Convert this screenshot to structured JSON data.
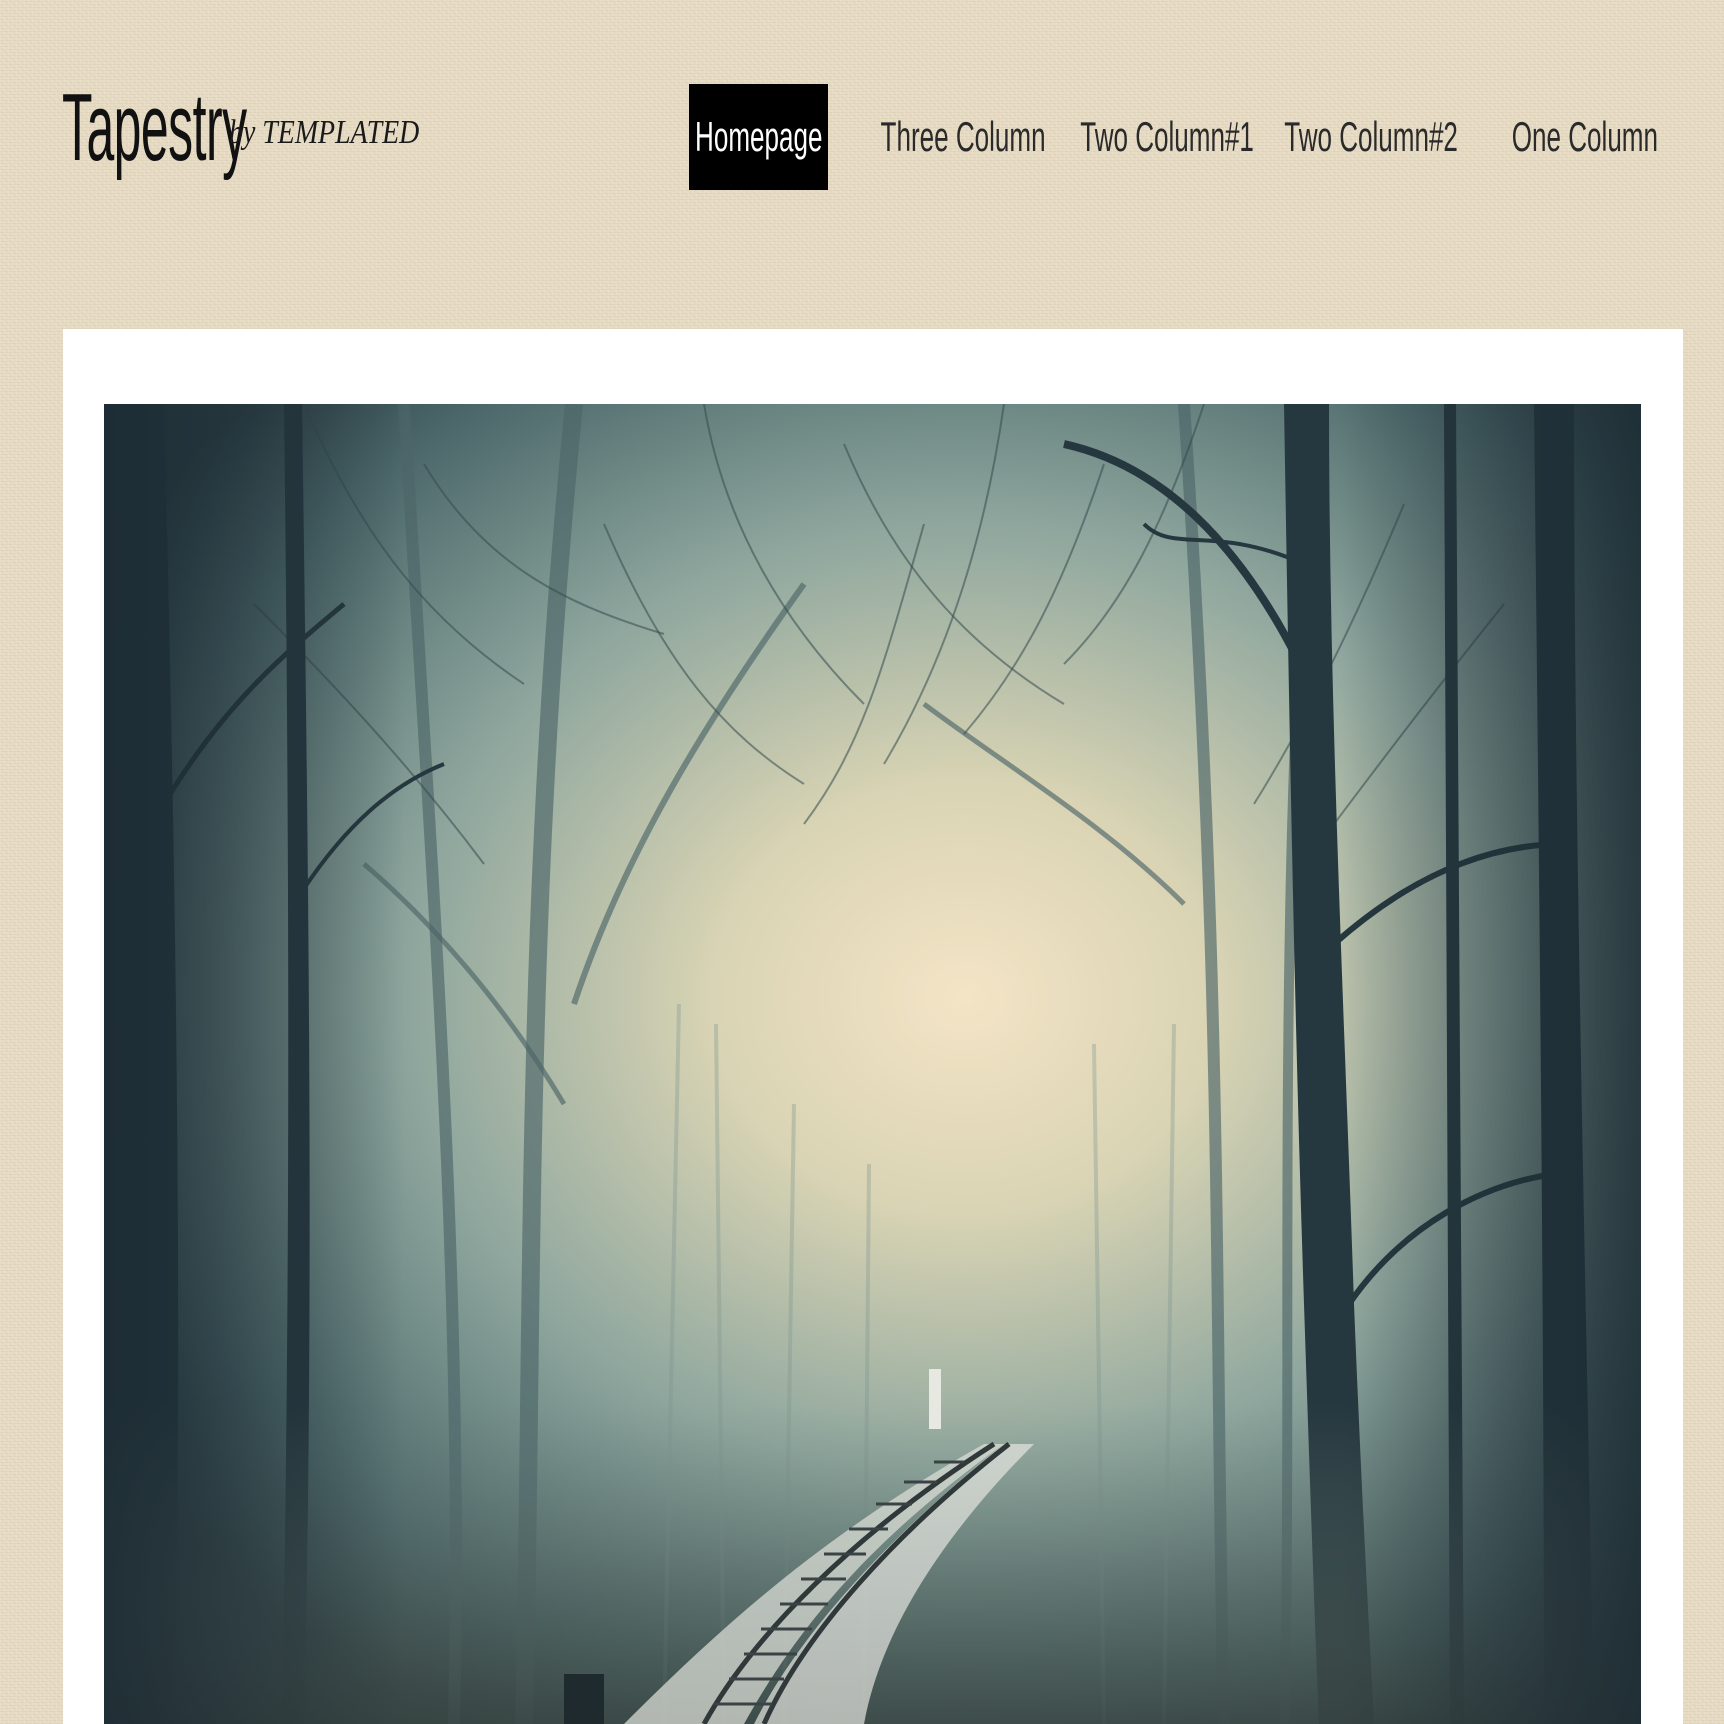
{
  "site": {
    "title": "Tapestry",
    "byline": "by TEMPLATED"
  },
  "nav": {
    "items": [
      {
        "label": "Homepage",
        "active": true
      },
      {
        "label": "Three Column",
        "active": false
      },
      {
        "label": "Two Column#1",
        "active": false
      },
      {
        "label": "Two Column#2",
        "active": false
      },
      {
        "label": "One Column",
        "active": false
      }
    ]
  },
  "hero": {
    "image": "misty-forest-railway-photo"
  },
  "colors": {
    "background": "#e8dcc4",
    "nav_active_bg": "#000000",
    "nav_active_text": "#ffffff",
    "text": "#111111",
    "content_bg": "#ffffff"
  }
}
